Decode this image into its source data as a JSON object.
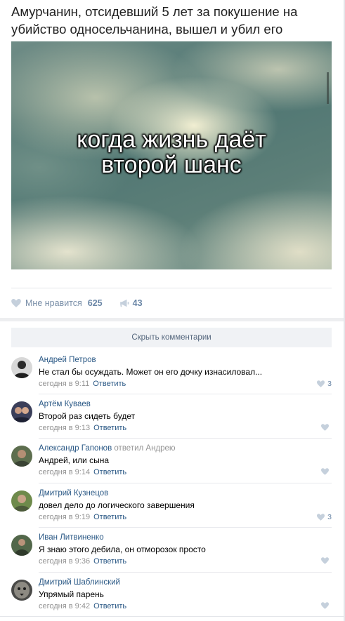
{
  "post": {
    "title": "Амурчанин, отсидевший 5 лет за покушение на убийство односельчанина, вышел и убил его",
    "image": {
      "caption_line1": "когда жизнь даёт",
      "caption_line2": "второй шанс"
    },
    "like_label": "Мне нравится",
    "like_count": "625",
    "share_count": "43"
  },
  "comments_header": {
    "hide_label": "Скрыть комментарии"
  },
  "comments": [
    {
      "author": "Андрей Петров",
      "reply_to": "",
      "text": "Не стал бы осуждать. Может он его дочку изнасиловал...",
      "time": "сегодня в 9:11",
      "reply_label": "Ответить",
      "likes": "3"
    },
    {
      "author": "Артём Куваев",
      "reply_to": "",
      "text": "Второй раз сидеть будет",
      "time": "сегодня в 9:13",
      "reply_label": "Ответить",
      "likes": ""
    },
    {
      "author": "Александр Гапонов",
      "reply_to": "ответил Андрею",
      "text": "Андрей, или сына",
      "time": "сегодня в 9:14",
      "reply_label": "Ответить",
      "likes": ""
    },
    {
      "author": "Дмитрий Кузнецов",
      "reply_to": "",
      "text": "довел дело до логического завершения",
      "time": "сегодня в 9:19",
      "reply_label": "Ответить",
      "likes": "3"
    },
    {
      "author": "Иван Литвиненко",
      "reply_to": "",
      "text": "Я знаю этого дебила, он отморозок просто",
      "time": "сегодня в 9:36",
      "reply_label": "Ответить",
      "likes": ""
    },
    {
      "author": "Дмитрий Шаблинский",
      "reply_to": "",
      "text": "Упрямый парень",
      "time": "сегодня в 9:42",
      "reply_label": "Ответить",
      "likes": ""
    }
  ],
  "colors": {
    "link": "#2a5885",
    "meta": "#939393",
    "like_icon": "#c5d0dc"
  }
}
